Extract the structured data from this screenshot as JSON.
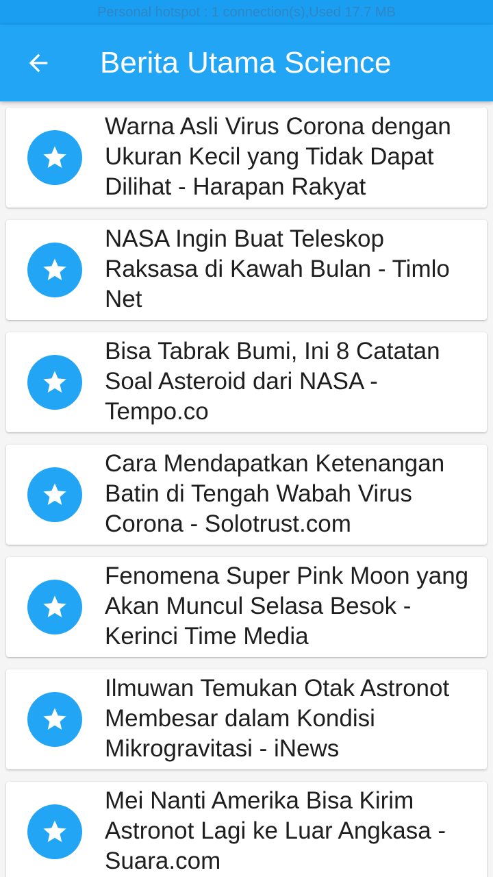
{
  "status_bar": {
    "text": "Personal hotspot : 1 connection(s),Used  17.7 MB"
  },
  "app_bar": {
    "title": "Berita Utama Science",
    "back_icon": "arrow-back-icon"
  },
  "colors": {
    "primary": "#21a5f4",
    "status_bar": "#1a9ef2",
    "card_background": "#ffffff",
    "text": "#1e1e1e"
  },
  "news": {
    "item_icon": "star-icon",
    "items": [
      {
        "title": "Warna Asli Virus Corona dengan Ukuran Kecil yang Tidak Dapat Dilihat - Harapan Rakyat"
      },
      {
        "title": "NASA Ingin Buat Teleskop Raksasa di Kawah Bulan - Timlo Net"
      },
      {
        "title": "Bisa Tabrak Bumi, Ini 8 Catatan Soal Asteroid dari NASA - Tempo.co"
      },
      {
        "title": "Cara Mendapatkan Ketenangan Batin di Tengah Wabah Virus Corona - Solotrust.com"
      },
      {
        "title": "Fenomena Super Pink Moon yang Akan Muncul Selasa Besok - Kerinci Time Media"
      },
      {
        "title": "Ilmuwan Temukan Otak Astronot Membesar dalam Kondisi Mikrogravitasi - iNews"
      },
      {
        "title": "Mei Nanti Amerika Bisa Kirim Astronot Lagi ke Luar Angkasa - Suara.com"
      }
    ]
  }
}
